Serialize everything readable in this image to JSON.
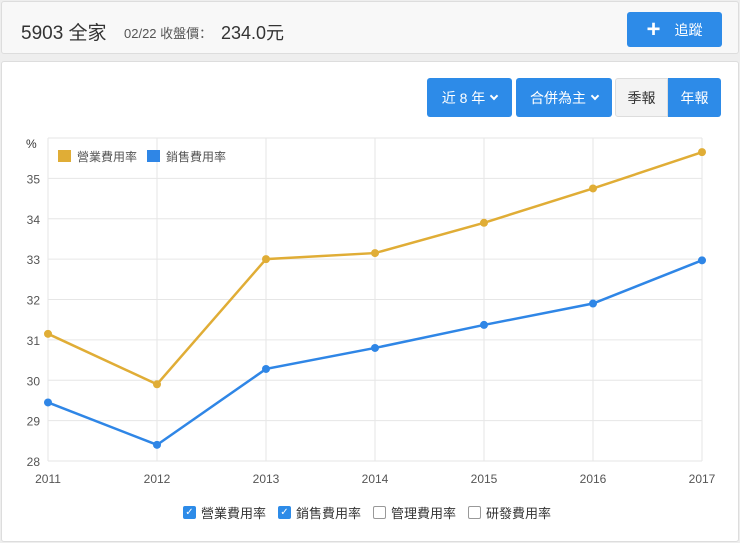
{
  "header": {
    "title": "5903 全家",
    "date": "02/22 收盤價：",
    "price": "234.0元",
    "follow_label": "追蹤",
    "follow_icon": "plus-icon"
  },
  "controls": {
    "period": "近 8 年",
    "scope": "合併為主",
    "quarterly": "季報",
    "annual": "年報"
  },
  "colors": {
    "accent": "#2d8be8",
    "orange": "#e0ad36",
    "blue": "#2f86e6"
  },
  "bottom_legend": [
    {
      "label": "營業費用率",
      "checked": true
    },
    {
      "label": "銷售費用率",
      "checked": true
    },
    {
      "label": "管理費用率",
      "checked": false
    },
    {
      "label": "研發費用率",
      "checked": false
    }
  ],
  "chart_data": {
    "type": "line",
    "ylabel": "%",
    "xlabel": "",
    "categories": [
      "2011",
      "2012",
      "2013",
      "2014",
      "2015",
      "2016",
      "2017"
    ],
    "ylim": [
      28,
      36
    ],
    "yticks": [
      "28",
      "29",
      "30",
      "31",
      "32",
      "33",
      "34",
      "35"
    ],
    "grid": true,
    "legend": "top-left",
    "series": [
      {
        "name": "營業費用率",
        "color": "#e0ad36",
        "values": [
          31.15,
          29.9,
          33.0,
          33.15,
          33.9,
          34.75,
          35.65
        ]
      },
      {
        "name": "銷售費用率",
        "color": "#2f86e6",
        "values": [
          29.45,
          28.4,
          30.28,
          30.8,
          31.37,
          31.9,
          32.97
        ]
      }
    ]
  }
}
